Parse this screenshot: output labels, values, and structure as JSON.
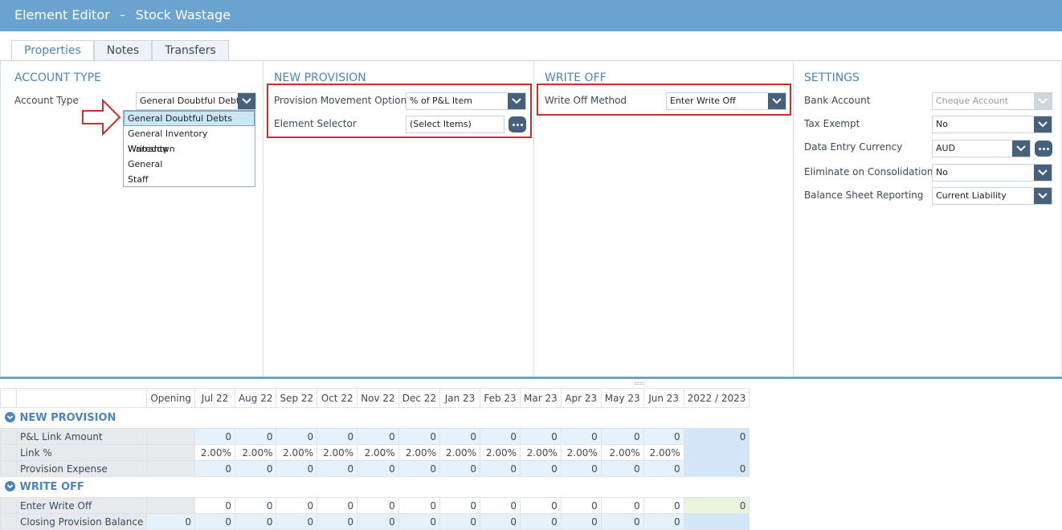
{
  "window": {
    "title": "Element Editor",
    "separator": "-",
    "element_name": "Stock Wastage"
  },
  "tabs": [
    "Properties",
    "Notes",
    "Transfers"
  ],
  "account_type": {
    "heading": "ACCOUNT TYPE",
    "label": "Account Type",
    "value": "General Doubtful Debt",
    "options": [
      "General Doubtful Debts",
      "General Inventory Writedown",
      "Warranty",
      "General",
      "Staff"
    ]
  },
  "new_provision": {
    "heading": "NEW PROVISION",
    "movement_label": "Provision Movement Option",
    "movement_value": "% of P&L Item",
    "selector_label": "Element Selector",
    "selector_value": "(Select Items)"
  },
  "write_off": {
    "heading": "WRITE OFF",
    "method_label": "Write Off Method",
    "method_value": "Enter Write Off"
  },
  "settings": {
    "heading": "SETTINGS",
    "bank_label": "Bank Account",
    "bank_value": "Cheque Account",
    "tax_label": "Tax Exempt",
    "tax_value": "No",
    "currency_label": "Data Entry Currency",
    "currency_value": "AUD",
    "elim_label": "Eliminate on Consolidation",
    "elim_value": "No",
    "bsr_label": "Balance Sheet Reporting",
    "bsr_value": "Current Liability"
  },
  "grid": {
    "columns": [
      "Opening",
      "Jul 22",
      "Aug 22",
      "Sep 22",
      "Oct 22",
      "Nov 22",
      "Dec 22",
      "Jan 23",
      "Feb 23",
      "Mar 23",
      "Apr 23",
      "May 23",
      "Jun 23",
      "2022 / 2023"
    ],
    "sections": [
      {
        "title": "NEW PROVISION",
        "rows": [
          {
            "label": "P&L Link  Amount",
            "opening": "",
            "months": [
              "0",
              "0",
              "0",
              "0",
              "0",
              "0",
              "0",
              "0",
              "0",
              "0",
              "0",
              "0"
            ],
            "total": "0"
          },
          {
            "label": "Link %",
            "opening": "",
            "months": [
              "2.00%",
              "2.00%",
              "2.00%",
              "2.00%",
              "2.00%",
              "2.00%",
              "2.00%",
              "2.00%",
              "2.00%",
              "2.00%",
              "2.00%",
              "2.00%"
            ],
            "total": ""
          },
          {
            "label": "Provision Expense",
            "opening": "",
            "months": [
              "0",
              "0",
              "0",
              "0",
              "0",
              "0",
              "0",
              "0",
              "0",
              "0",
              "0",
              "0"
            ],
            "total": "0"
          }
        ]
      },
      {
        "title": "WRITE OFF",
        "rows": [
          {
            "label": "Enter Write Off",
            "opening": "",
            "months": [
              "0",
              "0",
              "0",
              "0",
              "0",
              "0",
              "0",
              "0",
              "0",
              "0",
              "0",
              "0"
            ],
            "total": "0"
          },
          {
            "label": "Closing Provision Balance",
            "opening": "0",
            "months": [
              "0",
              "0",
              "0",
              "0",
              "0",
              "0",
              "0",
              "0",
              "0",
              "0",
              "0",
              "0"
            ],
            "total": ""
          }
        ]
      }
    ]
  }
}
